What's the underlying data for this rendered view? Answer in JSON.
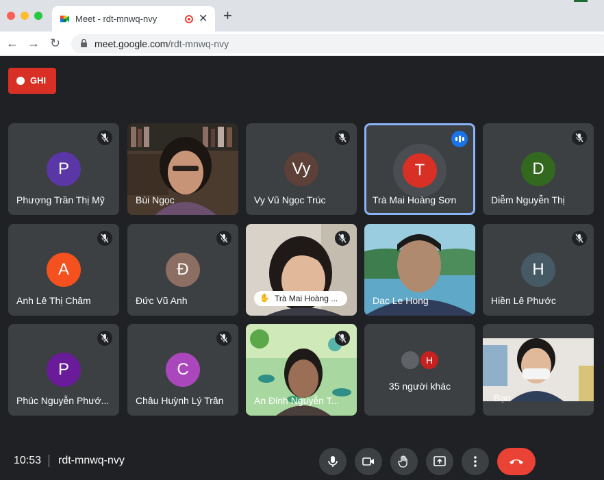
{
  "browser": {
    "tab_title": "Meet - rdt-mnwq-nvy",
    "url_host": "meet.google.com",
    "url_path": "/rdt-mnwq-nvy"
  },
  "record_button": {
    "label": "GHI",
    "color": "#d93025"
  },
  "participants": [
    {
      "name": "Phượng Trần Thị Mỹ",
      "initial": "P",
      "avatar_color": "#5b36a6",
      "muted": true
    },
    {
      "name": "Bùi Ngọc",
      "video": true,
      "muted": false
    },
    {
      "name": "Vy Vũ Ngọc Trúc",
      "initial": "Vy",
      "avatar_color": "#5d4037",
      "muted": true
    },
    {
      "name": "Trà Mai Hoàng Sơn",
      "initial": "T",
      "avatar_color": "#d93025",
      "speaking": true
    },
    {
      "name": "Diễm Nguyễn Thị",
      "initial": "D",
      "avatar_color": "#33691e",
      "muted": true
    },
    {
      "name": "Anh Lê Thị Châm",
      "initial": "A",
      "avatar_color": "#f4511e",
      "muted": true
    },
    {
      "name": "Đức Vũ Anh",
      "initial": "Đ",
      "avatar_color": "#8d6e63",
      "muted": true
    },
    {
      "name": "Trà Mai Hoàng ...",
      "video": true,
      "muted": true,
      "hand_raised": true
    },
    {
      "name": "Dac Le Hong",
      "video": true,
      "muted": false
    },
    {
      "name": "Hiền Lê Phước",
      "initial": "H",
      "avatar_color": "#455a64",
      "muted": true
    },
    {
      "name": "Phúc Nguyễn Phướ...",
      "initial": "P",
      "avatar_color": "#6a1b9a",
      "muted": true
    },
    {
      "name": "Châu Huỳnh Lý Trân",
      "initial": "C",
      "avatar_color": "#ab47bc",
      "muted": true
    },
    {
      "name": "An Đinh Nguyễn T...",
      "video": true,
      "muted": true
    },
    {
      "name": "35 người khác",
      "initial": "H"
    },
    {
      "name": "Bạn",
      "video": true
    }
  ],
  "bottom_bar": {
    "time": "10:53",
    "meeting_code": "rdt-mnwq-nvy"
  },
  "controls": [
    "mic-icon",
    "camera-icon",
    "raise-hand-icon",
    "present-icon",
    "more-icon",
    "end-call-icon"
  ]
}
